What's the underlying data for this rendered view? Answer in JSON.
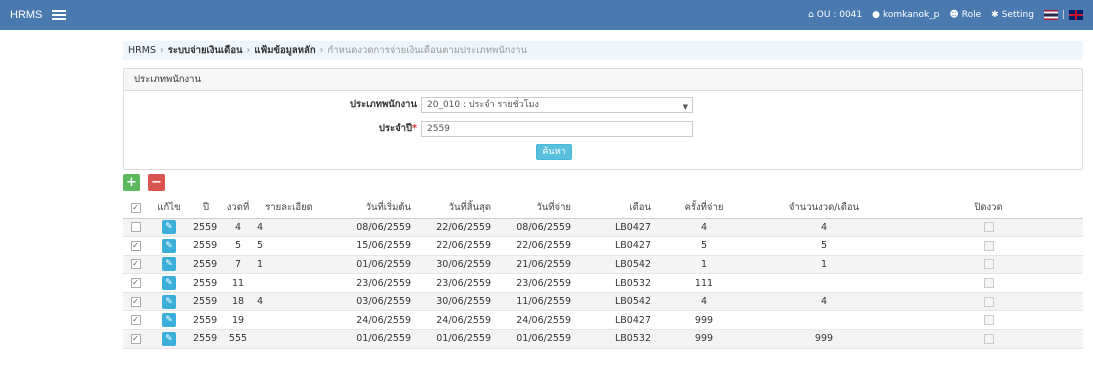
{
  "navbar": {
    "brand": "HRMS",
    "ou_label": "OU : 0041",
    "user": "komkanok_p",
    "role": "Role",
    "setting": "Setting",
    "lang_separator": "|"
  },
  "breadcrumb": {
    "items": [
      "HRMS",
      "ระบบจ่ายเงินเดือน",
      "แฟ้มข้อมูลหลัก"
    ],
    "current": "กำหนดงวดการจ่ายเงินเดือนตามประเภทพนักงาน"
  },
  "search_panel": {
    "heading": "ประเภทพนักงาน",
    "employee_type_label": "ประเภทพนักงาน",
    "employee_type_value": "20_010 : ประจำ รายชั่วโมง",
    "year_label": "ประจำปี",
    "year_required_mark": "*",
    "year_value": "2559",
    "search_button": "ค้นหา"
  },
  "toolbar": {
    "add_label": "+",
    "delete_label": "−"
  },
  "table": {
    "columns": [
      "แก้ไข",
      "ปี",
      "งวดที่",
      "รายละเอียด",
      "วันที่เริ่มต้น",
      "วันที่สิ้นสุด",
      "วันที่จ่าย",
      "เดือน",
      "ครั้งที่จ่าย",
      "จำนวนงวด/เดือน",
      "ปิดงวด"
    ],
    "rows": [
      {
        "checked": false,
        "year": "2559",
        "period": "4",
        "detail": "4",
        "start": "08/06/2559",
        "end": "22/06/2559",
        "pay": "08/06/2559",
        "month": "LB0427",
        "times": "4",
        "per_month": "4"
      },
      {
        "checked": true,
        "year": "2559",
        "period": "5",
        "detail": "5",
        "start": "15/06/2559",
        "end": "22/06/2559",
        "pay": "22/06/2559",
        "month": "LB0427",
        "times": "5",
        "per_month": "5"
      },
      {
        "checked": true,
        "year": "2559",
        "period": "7",
        "detail": "1",
        "start": "01/06/2559",
        "end": "30/06/2559",
        "pay": "21/06/2559",
        "month": "LB0542",
        "times": "1",
        "per_month": "1"
      },
      {
        "checked": true,
        "year": "2559",
        "period": "11",
        "detail": "",
        "start": "23/06/2559",
        "end": "23/06/2559",
        "pay": "23/06/2559",
        "month": "LB0532",
        "times": "111",
        "per_month": ""
      },
      {
        "checked": true,
        "year": "2559",
        "period": "18",
        "detail": "4",
        "start": "03/06/2559",
        "end": "30/06/2559",
        "pay": "11/06/2559",
        "month": "LB0542",
        "times": "4",
        "per_month": "4"
      },
      {
        "checked": true,
        "year": "2559",
        "period": "19",
        "detail": "",
        "start": "24/06/2559",
        "end": "24/06/2559",
        "pay": "24/06/2559",
        "month": "LB0427",
        "times": "999",
        "per_month": ""
      },
      {
        "checked": true,
        "year": "2559",
        "period": "555",
        "detail": "",
        "start": "01/06/2559",
        "end": "01/06/2559",
        "pay": "01/06/2559",
        "month": "LB0532",
        "times": "999",
        "per_month": "999"
      }
    ]
  }
}
